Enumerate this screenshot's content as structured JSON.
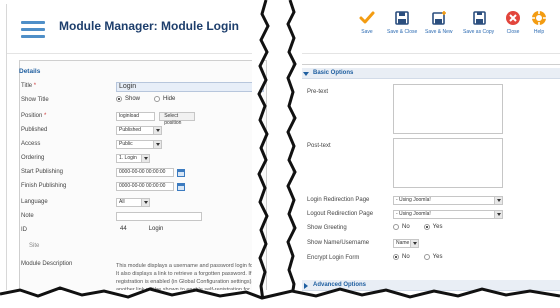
{
  "left": {
    "title": "Module Manager: Module Login",
    "legend": "Details",
    "fields": {
      "title_label": "Title",
      "title_value": "Login",
      "show_title_label": "Show Title",
      "show_option": "Show",
      "hide_option": "Hide",
      "position_label": "Position",
      "position_value": "loginload",
      "select_position": "Select position",
      "published_label": "Published",
      "published_value": "Published",
      "access_label": "Access",
      "access_value": "Public",
      "ordering_label": "Ordering",
      "ordering_value": "1. Login",
      "start_label": "Start Publishing",
      "start_value": "0000-00-00 00:00:00",
      "finish_label": "Finish Publishing",
      "finish_value": "0000-00-00 00:00:00",
      "language_label": "Language",
      "language_value": "All",
      "note_label": "Note",
      "note_value": "",
      "id_label": "ID",
      "id_value": "44",
      "id_type": "Login",
      "site_label": "Site",
      "desc_label": "Module Description",
      "desc_text": "This module displays a username and password login form. It also displays a link to retrieve a forgotten password. If user registration is enabled (in Global Configuration settings), another link will be shown to enable self-registration for users."
    }
  },
  "toolbar": [
    {
      "label": "Save",
      "icon": "checkmark-icon",
      "color": "#f39c12"
    },
    {
      "label": "Save & Close",
      "icon": "save-close-icon",
      "color": "#2b4e7e"
    },
    {
      "label": "Save & New",
      "icon": "save-new-icon",
      "color": "#2b4e7e"
    },
    {
      "label": "Save as Copy",
      "icon": "save-copy-icon",
      "color": "#2b4e7e"
    },
    {
      "label": "Close",
      "icon": "close-icon",
      "color": "#e2453c"
    },
    {
      "label": "Help",
      "icon": "help-icon",
      "color": "#f39c12"
    }
  ],
  "right": {
    "basic_options": "Basic Options",
    "pretext_label": "Pre-text",
    "posttext_label": "Post-text",
    "login_redirect_label": "Login Redirection Page",
    "login_redirect_value": "- Using Joomla!",
    "logout_redirect_label": "Logout Redirection Page",
    "logout_redirect_value": "- Using Joomla!",
    "show_greeting_label": "Show Greeting",
    "show_name_label": "Show Name/Username",
    "show_name_value": "Name",
    "encrypt_label": "Encrypt Login Form",
    "no_option": "No",
    "yes_option": "Yes",
    "advanced_options": "Advanced Options"
  },
  "colors": {
    "accent": "#1f5fa0",
    "title": "#1d3e6c",
    "menu_icon": "#4f8fc8"
  }
}
